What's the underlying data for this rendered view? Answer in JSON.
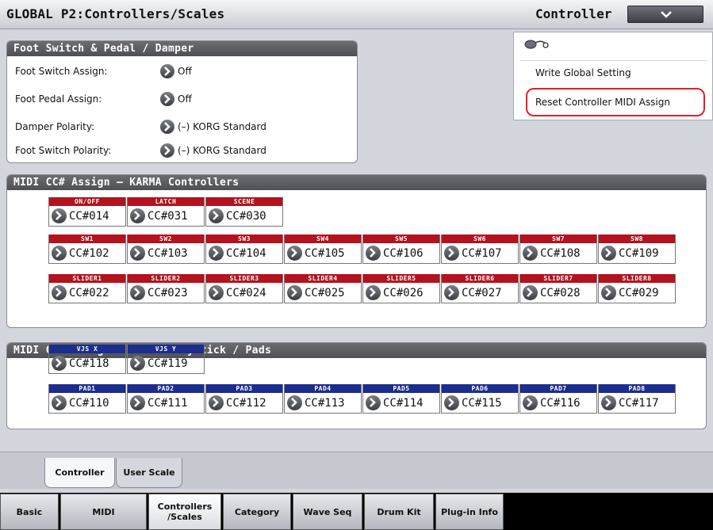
{
  "header": {
    "title": "GLOBAL P2:Controllers/Scales",
    "page_select": "Controller"
  },
  "popup_menu": {
    "write": "Write Global Setting",
    "reset": "Reset Controller MIDI Assign"
  },
  "foot_panel": {
    "title": "Foot Switch & Pedal / Damper",
    "rows": [
      {
        "label": "Foot Switch Assign:",
        "value": "Off"
      },
      {
        "label": "Foot Pedal Assign:",
        "value": "Off"
      },
      {
        "label": "Damper Polarity:",
        "value": "(–) KORG Standard"
      },
      {
        "label": "Foot Switch Polarity:",
        "value": "(–) KORG Standard"
      }
    ]
  },
  "karma_panel": {
    "title": "MIDI CC# Assign – KARMA Controllers",
    "row1": [
      {
        "tag": "ON/OFF",
        "value": "CC#014"
      },
      {
        "tag": "LATCH",
        "value": "CC#031"
      },
      {
        "tag": "SCENE",
        "value": "CC#030"
      }
    ],
    "row2": [
      {
        "tag": "SW1",
        "value": "CC#102"
      },
      {
        "tag": "SW2",
        "value": "CC#103"
      },
      {
        "tag": "SW3",
        "value": "CC#104"
      },
      {
        "tag": "SW4",
        "value": "CC#105"
      },
      {
        "tag": "SW5",
        "value": "CC#106"
      },
      {
        "tag": "SW6",
        "value": "CC#107"
      },
      {
        "tag": "SW7",
        "value": "CC#108"
      },
      {
        "tag": "SW8",
        "value": "CC#109"
      }
    ],
    "row3": [
      {
        "tag": "SLIDER1",
        "value": "CC#022"
      },
      {
        "tag": "SLIDER2",
        "value": "CC#023"
      },
      {
        "tag": "SLIDER3",
        "value": "CC#024"
      },
      {
        "tag": "SLIDER4",
        "value": "CC#025"
      },
      {
        "tag": "SLIDER5",
        "value": "CC#026"
      },
      {
        "tag": "SLIDER6",
        "value": "CC#027"
      },
      {
        "tag": "SLIDER7",
        "value": "CC#028"
      },
      {
        "tag": "SLIDER8",
        "value": "CC#029"
      }
    ]
  },
  "vector_panel": {
    "title": "MIDI CC# Assign – Vector Joystick / Pads",
    "row1": [
      {
        "tag": "VJS X",
        "value": "CC#118"
      },
      {
        "tag": "VJS Y",
        "value": "CC#119"
      }
    ],
    "row2": [
      {
        "tag": "PAD1",
        "value": "CC#110"
      },
      {
        "tag": "PAD2",
        "value": "CC#111"
      },
      {
        "tag": "PAD3",
        "value": "CC#112"
      },
      {
        "tag": "PAD4",
        "value": "CC#113"
      },
      {
        "tag": "PAD5",
        "value": "CC#114"
      },
      {
        "tag": "PAD6",
        "value": "CC#115"
      },
      {
        "tag": "PAD7",
        "value": "CC#116"
      },
      {
        "tag": "PAD8",
        "value": "CC#117"
      }
    ]
  },
  "sub_tabs": [
    "Controller",
    "User Scale"
  ],
  "page_tabs": [
    "Basic",
    "MIDI",
    "Controllers /Scales",
    "Category",
    "Wave Seq",
    "Drum Kit",
    "Plug-in Info"
  ],
  "colors": {
    "karma_tag": "#b3121e",
    "vector_tag": "#1c2d8e",
    "highlight": "#e0202a"
  }
}
